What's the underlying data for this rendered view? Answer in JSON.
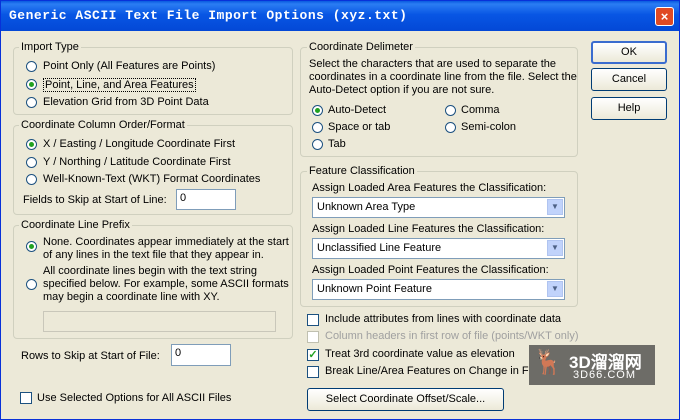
{
  "window": {
    "title": "Generic ASCII Text File Import Options (xyz.txt)",
    "close_label": "×"
  },
  "import_type": {
    "label": "Import Type",
    "options": [
      "Point Only (All Features are Points)",
      "Point, Line, and Area Features",
      "Elevation Grid from 3D Point Data"
    ],
    "selected": 1
  },
  "coord_order": {
    "label": "Coordinate Column Order/Format",
    "options": [
      "X / Easting / Longitude Coordinate First",
      "Y / Northing / Latitude Coordinate First",
      "Well-Known-Text (WKT) Format Coordinates"
    ],
    "selected": 0,
    "fields_label": "Fields to Skip at Start of Line:",
    "fields_value": "0"
  },
  "line_prefix": {
    "label": "Coordinate Line Prefix",
    "option1_line1": "None. Coordinates appear immediately at the start",
    "option1_line2": "of any lines in the text file that they appear in.",
    "option2_line1": "All coordinate lines begin with the text string",
    "option2_line2": "specified below. For example, some ASCII formats",
    "option2_line3": "may begin a coordinate line with XY.",
    "prefix_value": ""
  },
  "rows_skip": {
    "label": "Rows to Skip at Start of File:",
    "value": "0"
  },
  "use_selected": {
    "label": "Use Selected Options for All ASCII Files"
  },
  "delimiter": {
    "label": "Coordinate Delimeter",
    "desc1": "Select the characters that are used to separate the",
    "desc2": "coordinates in a coordinate line from the file. Select the",
    "desc3": "Auto-Detect option if you are not sure.",
    "auto": "Auto-Detect",
    "comma": "Comma",
    "space": "Space or tab",
    "semi": "Semi-colon",
    "tab": "Tab"
  },
  "classification": {
    "label": "Feature Classification",
    "area_label": "Assign Loaded Area Features the Classification:",
    "area_value": "Unknown Area Type",
    "line_label": "Assign Loaded Line Features the Classification:",
    "line_value": "Unclassified Line Feature",
    "point_label": "Assign Loaded Point Features the Classification:",
    "point_value": "Unknown Point Feature"
  },
  "checks": {
    "include_attrs": "Include attributes from lines with coordinate data",
    "headers": "Column headers in first row of file (points/WKT only)",
    "treat_3rd": "Treat 3rd coordinate value as elevation",
    "break_line": "Break Line/Area Features on Change in F"
  },
  "buttons": {
    "ok": "OK",
    "cancel": "Cancel",
    "help": "Help",
    "offset": "Select Coordinate Offset/Scale..."
  },
  "watermark": {
    "line1": "3D溜溜网",
    "line2": "3D66.COM"
  }
}
